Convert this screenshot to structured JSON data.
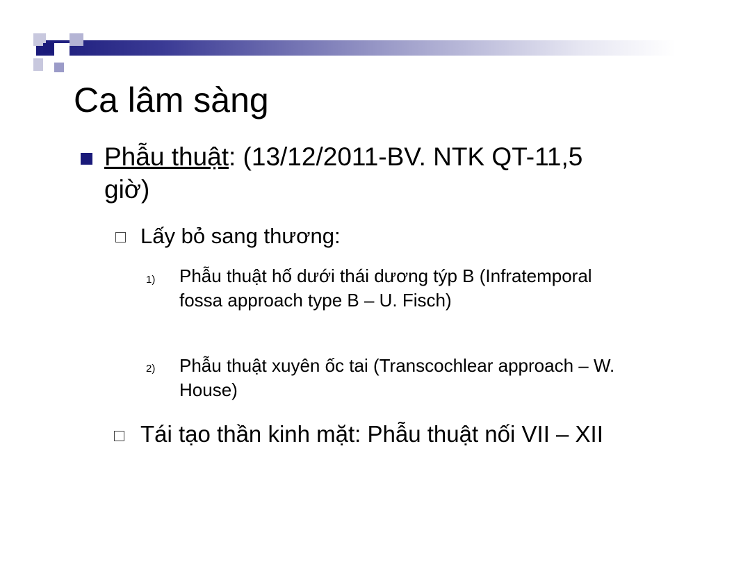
{
  "slide": {
    "title": "Ca lâm sàng",
    "main_bullet": {
      "label": "Phẫu thuật",
      "text": ": (13/12/2011-BV. NTK QT-11,5 giờ)"
    },
    "sub_bullets": [
      {
        "text": "Lấy bỏ sang thương:",
        "items": [
          {
            "number": "1)",
            "text": "Phẫu thuật hố dưới thái dương týp B (Infratemporal fossa approach type B – U. Fisch)"
          },
          {
            "number": "2)",
            "text": "Phẫu thuật xuyên ốc tai (Transcochlear approach – W. House)"
          }
        ]
      },
      {
        "text": "Tái tạo thần kinh mặt: Phẫu thuật nối VII – XII"
      }
    ]
  },
  "colors": {
    "accent": "#1a1a7a",
    "text": "#000000"
  }
}
